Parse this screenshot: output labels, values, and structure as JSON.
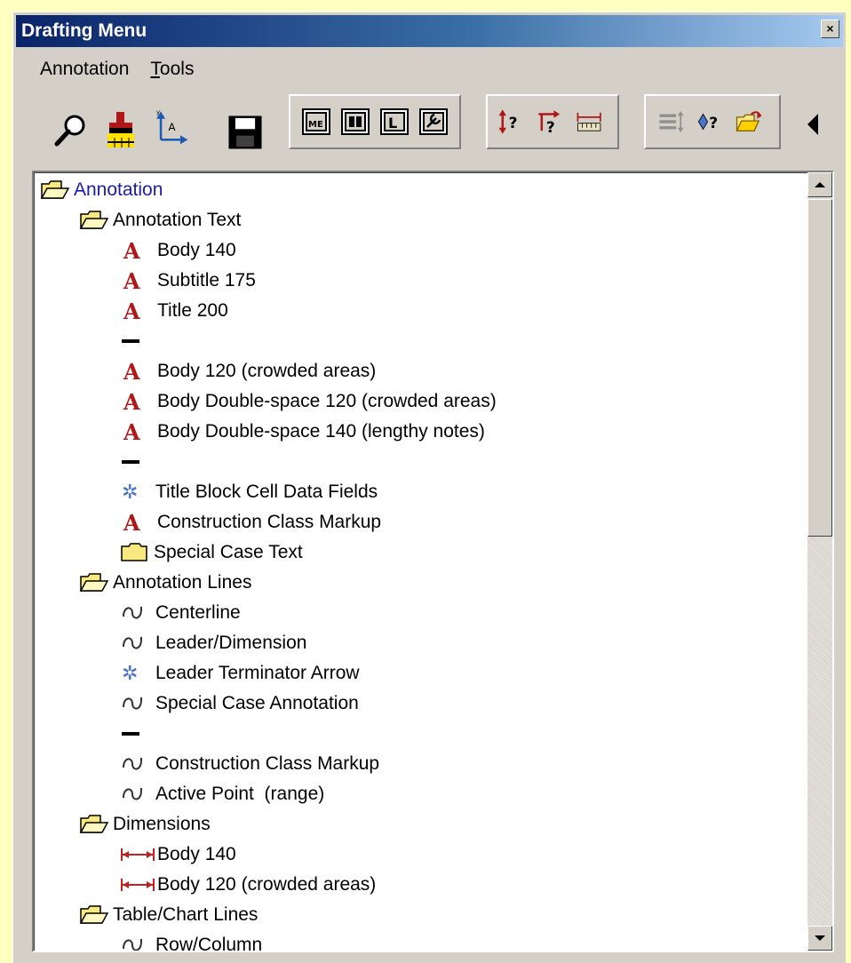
{
  "window": {
    "title": "Drafting Menu",
    "close_glyph": "×"
  },
  "menu": {
    "items": [
      {
        "label": "Annotation"
      },
      {
        "label": "Tools",
        "mnemonic": "T"
      }
    ]
  },
  "toolbar": {
    "buttons": [
      {
        "icon": "magnifier-icon"
      },
      {
        "icon": "paint-brush-icon"
      },
      {
        "icon": "axis-text-icon"
      },
      {
        "icon": "save-disk-icon"
      },
      {
        "icon": "me-frame-icon"
      },
      {
        "icon": "double-frame-icon"
      },
      {
        "icon": "l-frame-icon"
      },
      {
        "icon": "wrench-frame-icon"
      },
      {
        "icon": "vertical-query-icon"
      },
      {
        "icon": "leader-query-icon"
      },
      {
        "icon": "dimension-ruler-icon"
      },
      {
        "icon": "list-settings-icon"
      },
      {
        "icon": "diamond-query-icon"
      },
      {
        "icon": "open-folder-arrow-icon"
      },
      {
        "icon": "collapse-left-icon"
      }
    ]
  },
  "tree": {
    "items": [
      {
        "label": "Annotation",
        "icon": "open-folder-icon",
        "level": 0
      },
      {
        "label": "Annotation Text",
        "icon": "open-folder-icon",
        "level": 1
      },
      {
        "label": "Body 140",
        "icon": "text-a-icon",
        "level": 2
      },
      {
        "label": "Subtitle 175",
        "icon": "text-a-icon",
        "level": 2
      },
      {
        "label": "Title 200",
        "icon": "text-a-icon",
        "level": 2
      },
      {
        "label": "",
        "icon": "separator-icon",
        "level": 2
      },
      {
        "label": "Body 120 (crowded areas)",
        "icon": "text-a-icon",
        "level": 2
      },
      {
        "label": "Body Double-space 120 (crowded areas)",
        "icon": "text-a-icon",
        "level": 2
      },
      {
        "label": "Body Double-space 140 (lengthy notes)",
        "icon": "text-a-icon",
        "level": 2
      },
      {
        "label": "",
        "icon": "separator-icon",
        "level": 2
      },
      {
        "label": "Title Block Cell Data Fields",
        "icon": "cell-snowflake-icon",
        "level": 2
      },
      {
        "label": "Construction Class Markup",
        "icon": "text-a-icon",
        "level": 2
      },
      {
        "label": "Special Case Text",
        "icon": "closed-folder-icon",
        "level": 2
      },
      {
        "label": "Annotation Lines",
        "icon": "open-folder-icon",
        "level": 1
      },
      {
        "label": "Centerline",
        "icon": "curve-icon",
        "level": 2
      },
      {
        "label": "Leader/Dimension",
        "icon": "curve-icon",
        "level": 2
      },
      {
        "label": "Leader Terminator Arrow",
        "icon": "cell-snowflake-icon",
        "level": 2
      },
      {
        "label": "Special Case Annotation",
        "icon": "curve-icon",
        "level": 2
      },
      {
        "label": "",
        "icon": "separator-icon",
        "level": 2
      },
      {
        "label": "Construction Class Markup",
        "icon": "curve-icon",
        "level": 2
      },
      {
        "label": "Active Point  (range)",
        "icon": "curve-icon",
        "level": 2
      },
      {
        "label": "Dimensions",
        "icon": "open-folder-icon",
        "level": 1
      },
      {
        "label": "Body 140",
        "icon": "dimension-icon",
        "level": 2
      },
      {
        "label": "Body 120 (crowded areas)",
        "icon": "dimension-icon",
        "level": 2
      },
      {
        "label": "Table/Chart Lines",
        "icon": "open-folder-icon",
        "level": 1
      },
      {
        "label": "Row/Column",
        "icon": "curve-icon",
        "level": 2
      }
    ]
  },
  "colors": {
    "desktop": "#ffffc0",
    "titlebar_start": "#0a246a",
    "titlebar_end": "#a6caf0",
    "root_label": "#1c1ca8",
    "text_icon": "#b01818",
    "dimension_icon": "#c02020",
    "folder_fill": "#f8e880"
  }
}
